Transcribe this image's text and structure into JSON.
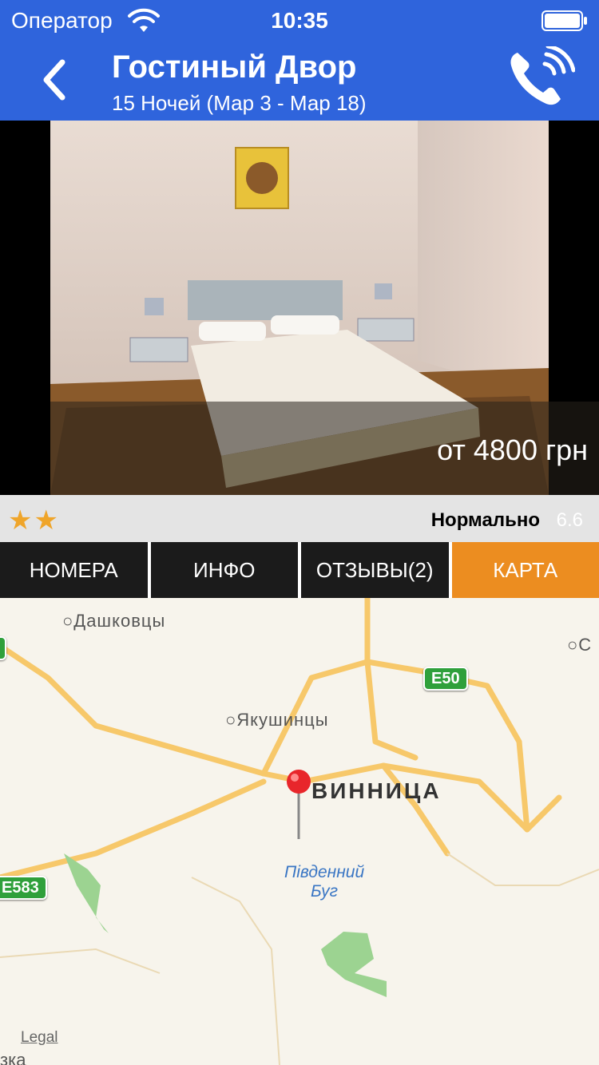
{
  "status_bar": {
    "carrier": "Оператор",
    "time": "10:35"
  },
  "header": {
    "title": "Гостиный Двор",
    "subtitle": "15 Ночей (Мар 3 - Мар 18)"
  },
  "photo": {
    "price": "от 4800 грн"
  },
  "rating": {
    "stars": "★★",
    "label": "Нормально",
    "score": "6.6"
  },
  "tabs": [
    {
      "label": "НОМЕРА",
      "active": false
    },
    {
      "label": "ИНФО",
      "active": false
    },
    {
      "label": "ОТЗЫВЫ(2)",
      "active": false
    },
    {
      "label": "КАРТА",
      "active": true
    }
  ],
  "map": {
    "places": [
      "Дашковцы",
      "Якушинцы",
      "С"
    ],
    "city": "ВИННИЦА",
    "river": "Південний Буг",
    "road_e50": "E50",
    "road_e583": "E583",
    "legal": "Legal",
    "edge_text": "зка"
  },
  "colors": {
    "header": "#2f64dc",
    "active_tab": "#ec8d20",
    "tab": "#1b1b1b",
    "star": "#efa52a"
  }
}
